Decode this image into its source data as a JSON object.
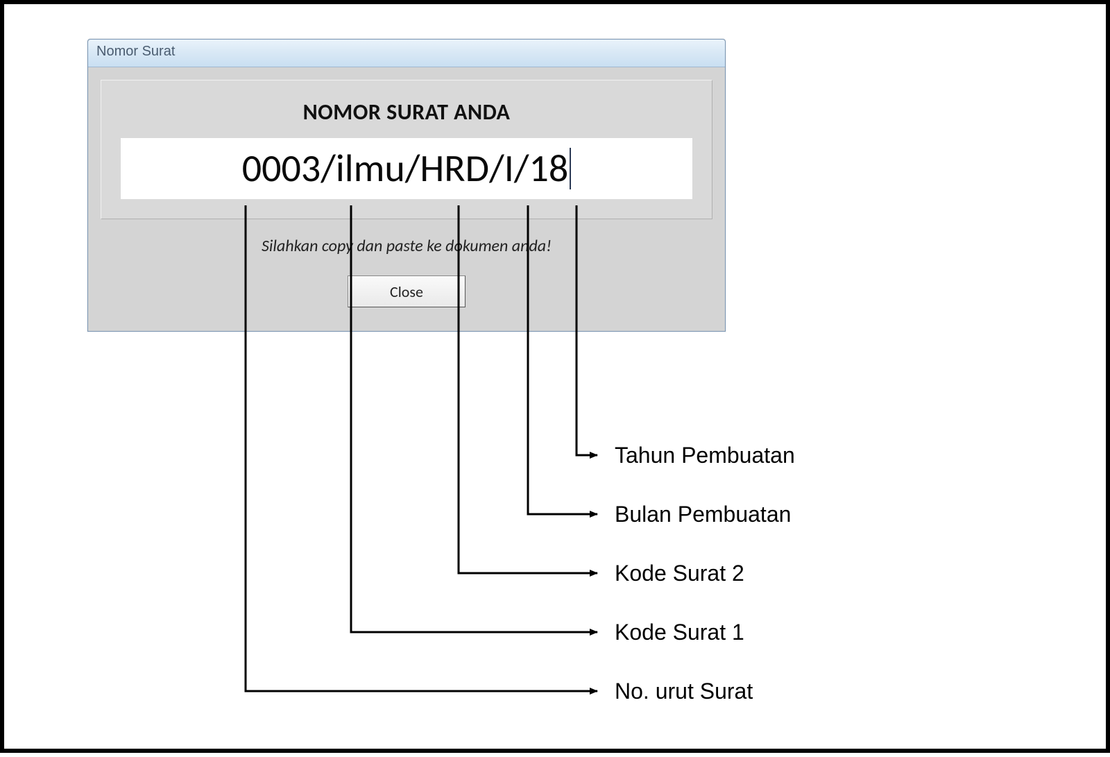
{
  "dialog": {
    "title": "Nomor Surat",
    "heading": "NOMOR SURAT ANDA",
    "nomor_value": "0003/ilmu/HRD/I/18",
    "instruction": "Silahkan copy dan paste ke dokumen anda!",
    "close_label": "Close"
  },
  "annotations": {
    "tahun": "Tahun Pembuatan",
    "bulan": "Bulan Pembuatan",
    "kode2": "Kode Surat 2",
    "kode1": "Kode Surat 1",
    "nourut": "No. urut Surat"
  },
  "nomor_parts": {
    "no_urut": "0003",
    "kode_surat_1": "ilmu",
    "kode_surat_2": "HRD",
    "bulan": "I",
    "tahun": "18"
  }
}
